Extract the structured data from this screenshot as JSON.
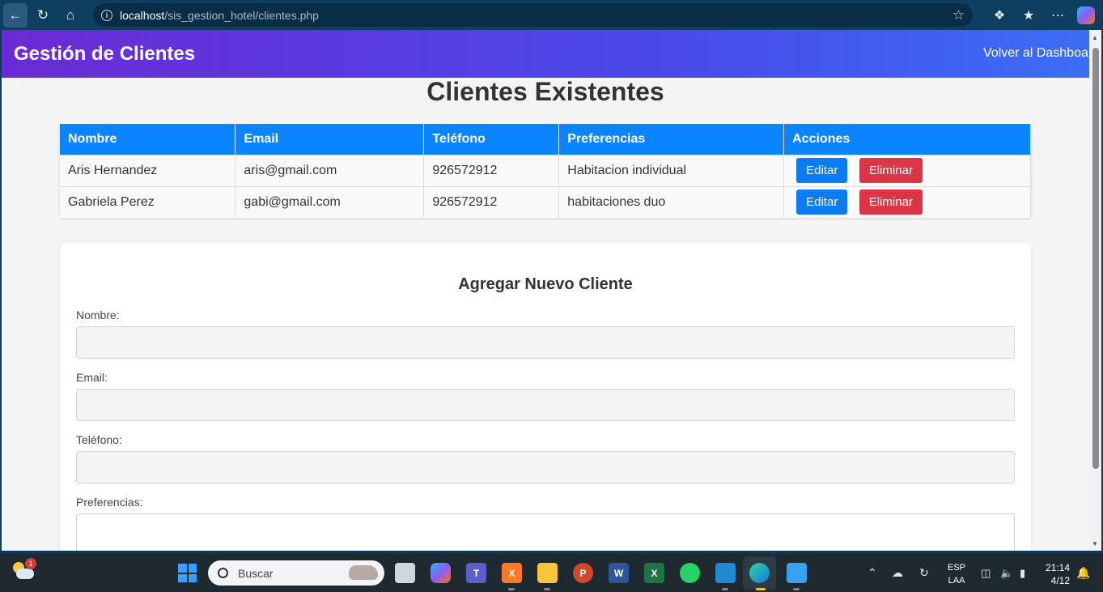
{
  "browser": {
    "url_host": "localhost",
    "url_path": "/sis_gestion_hotel/clientes.php"
  },
  "header": {
    "title": "Gestión de Clientes",
    "back_link": "Volver al Dashboa"
  },
  "clients": {
    "title": "Clientes Existentes",
    "columns": [
      "Nombre",
      "Email",
      "Teléfono",
      "Preferencias",
      "Acciones"
    ],
    "rows": [
      {
        "nombre": "Aris Hernandez",
        "email": "aris@gmail.com",
        "telefono": "926572912",
        "preferencias": "Habitacion individual"
      },
      {
        "nombre": "Gabriela Perez",
        "email": "gabi@gmail.com",
        "telefono": "926572912",
        "preferencias": "habitaciones duo"
      }
    ],
    "edit_label": "Editar",
    "delete_label": "Eliminar"
  },
  "form": {
    "title": "Agregar Nuevo Cliente",
    "nombre_label": "Nombre:",
    "email_label": "Email:",
    "telefono_label": "Teléfono:",
    "preferencias_label": "Preferencias:"
  },
  "taskbar": {
    "weather_badge": "1",
    "search_placeholder": "Buscar",
    "lang_top": "ESP",
    "lang_bottom": "LAA",
    "time": "21:14",
    "date": "4/12"
  },
  "colors": {
    "header_gradient_start": "#6a2bd4",
    "header_gradient_end": "#3b6ef5",
    "table_header": "#0b84ff",
    "edit_button": "#0b7cf4",
    "delete_button": "#dc3545"
  }
}
